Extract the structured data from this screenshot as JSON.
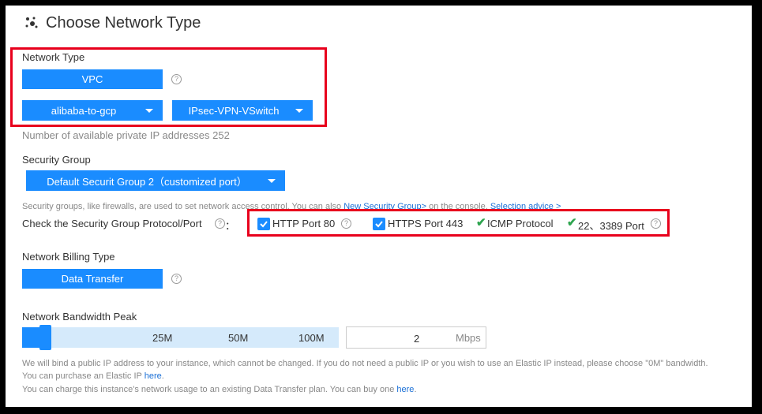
{
  "title": "Choose Network Type",
  "network_type": {
    "label": "Network Type",
    "vpc_button": "VPC",
    "vpc_dropdown": "alibaba-to-gcp",
    "vswitch_dropdown": "IPsec-VPN-VSwitch",
    "available_ip_text": "Number of available private IP addresses 252"
  },
  "security_group": {
    "label": "Security Group",
    "selected": "Default Securit Group 2（customized port）",
    "note_prefix": "Security groups, like firewalls, are used to set network access control. You can also ",
    "new_group_link": "New Security Group>",
    "note_mid": " on the console. ",
    "advice_link": "Selection advice >",
    "check_label": "Check the Security Group Protocol/Port",
    "check_colon": "：",
    "ports": [
      {
        "label": "HTTP Port 80",
        "kind": "checkbox",
        "help": true
      },
      {
        "label": "HTTPS Port 443",
        "kind": "checkbox",
        "help": false
      },
      {
        "label": "ICMP Protocol",
        "kind": "tick",
        "help": false
      },
      {
        "label": "22、3389 Port",
        "kind": "tick",
        "help": true
      }
    ]
  },
  "billing": {
    "label": "Network Billing Type",
    "selected": "Data Transfer"
  },
  "bandwidth": {
    "label": "Network Bandwidth Peak",
    "ticks": [
      "25M",
      "50M",
      "100M"
    ],
    "value": "2",
    "unit": "Mbps",
    "note_line1": "We will bind a public IP address to your instance, which cannot be changed. If you do not need a public IP or you wish to use an Elastic IP instead, please choose \"0M\" bandwidth.",
    "note_line2_prefix": "You can purchase an Elastic IP ",
    "note_line2_link": "here",
    "note_line2_suffix": ".",
    "note_line3_prefix": "You can charge this instance's network usage to an existing Data Transfer plan. You can buy one ",
    "note_line3_link": "here",
    "note_line3_suffix": "."
  },
  "colors": {
    "accent": "#1a8cff",
    "highlight": "#e8001c",
    "tick": "#2da44e"
  }
}
